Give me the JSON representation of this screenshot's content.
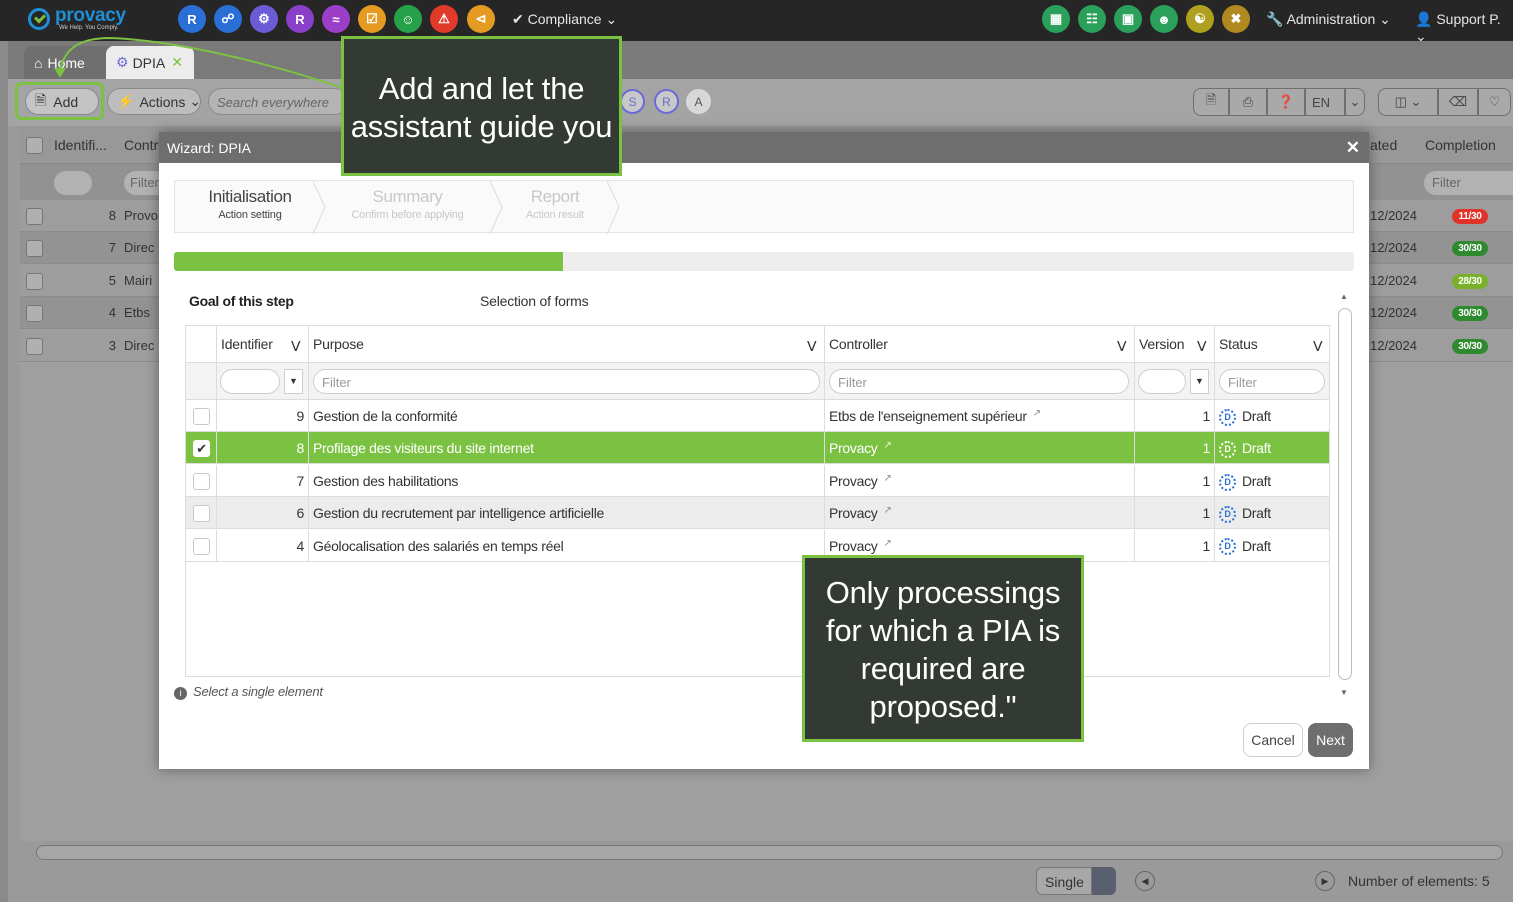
{
  "brand": {
    "name": "provacy",
    "tagline": "We Help. You Comply."
  },
  "topbar": {
    "app_icons": [
      {
        "label": "R",
        "color": "#2a6fd6",
        "icon": "letter-r"
      },
      {
        "label": "",
        "color": "#2a6fd6",
        "icon": "network-icon"
      },
      {
        "label": "",
        "color": "#6b5bd6",
        "icon": "gear-icon"
      },
      {
        "label": "R",
        "color": "#8a3fc8",
        "icon": "letter-r"
      },
      {
        "label": "",
        "color": "#9b3fc8",
        "icon": "handshake-icon"
      },
      {
        "label": "",
        "color": "#e59b22",
        "icon": "checklist-icon"
      },
      {
        "label": "",
        "color": "#27a04a",
        "icon": "user-icon"
      },
      {
        "label": "",
        "color": "#e23a2a",
        "icon": "shield-icon"
      },
      {
        "label": "",
        "color": "#e59b22",
        "icon": "share-icon"
      }
    ],
    "compliance": "Compliance",
    "right_icons": [
      {
        "color": "#2aa05a",
        "icon": "building-icon"
      },
      {
        "color": "#2aa05a",
        "icon": "org-chart-icon"
      },
      {
        "color": "#2aa05a",
        "icon": "office-icon"
      },
      {
        "color": "#2aa05a",
        "icon": "team-icon"
      },
      {
        "color": "#b0a020",
        "icon": "people-icon"
      },
      {
        "color": "#b08a20",
        "icon": "tools-icon"
      }
    ],
    "administration": "Administration",
    "support": "Support P."
  },
  "tabs": {
    "home": "Home",
    "dpia": "DPIA"
  },
  "toolbar": {
    "add": "Add",
    "actions": "Actions",
    "search_placeholder": "Search everywhere",
    "circles": [
      "S",
      "R",
      "A"
    ],
    "lang": "EN"
  },
  "bg_grid": {
    "headers": {
      "identifier": "Identifi...",
      "controller": "Contr",
      "updated": "ated",
      "completion": "Completion"
    },
    "filter": "Filter",
    "rows": [
      {
        "id": "8",
        "ctrl": "Provo",
        "date": "12/2024",
        "completion": "11/30",
        "color": "#e0342a"
      },
      {
        "id": "7",
        "ctrl": "Direc",
        "date": "12/2024",
        "completion": "30/30",
        "color": "#2f8a2f"
      },
      {
        "id": "5",
        "ctrl": "Mairi",
        "date": "12/2024",
        "completion": "28/30",
        "color": "#7ab02a"
      },
      {
        "id": "4",
        "ctrl": "Etbs",
        "date": "12/2024",
        "completion": "30/30",
        "color": "#2f8a2f"
      },
      {
        "id": "3",
        "ctrl": "Direc",
        "date": "12/2024",
        "completion": "30/30",
        "color": "#2f8a2f"
      }
    ]
  },
  "footer": {
    "single": "Single",
    "count": "Number of elements: 5"
  },
  "wizard": {
    "title": "Wizard: DPIA",
    "steps": [
      {
        "title": "Initialisation",
        "sub": "Action setting"
      },
      {
        "title": "Summary",
        "sub": "Confirm before applying"
      },
      {
        "title": "Report",
        "sub": "Action result"
      }
    ],
    "progress": 0.33,
    "goal": "Goal of this step",
    "selection": "Selection of forms",
    "columns": {
      "identifier": "Identifier",
      "purpose": "Purpose",
      "controller": "Controller",
      "version": "Version",
      "status": "Status"
    },
    "filter_placeholder": "Filter",
    "rows": [
      {
        "id": "9",
        "purpose": "Gestion de la conformité",
        "controller": "Etbs de l'enseignement supérieur",
        "version": "1",
        "status": "Draft"
      },
      {
        "id": "8",
        "purpose": "Profilage des visiteurs du site internet",
        "controller": "Provacy",
        "version": "1",
        "status": "Draft"
      },
      {
        "id": "7",
        "purpose": "Gestion des habilitations",
        "controller": "Provacy",
        "version": "1",
        "status": "Draft"
      },
      {
        "id": "6",
        "purpose": "Gestion du recrutement par intelligence artificielle",
        "controller": "Provacy",
        "version": "1",
        "status": "Draft"
      },
      {
        "id": "4",
        "purpose": "Géolocalisation des salariés en temps réel",
        "controller": "Provacy",
        "version": "1",
        "status": "Draft"
      }
    ],
    "hint": "Select a single element",
    "cancel": "Cancel",
    "next": "Next"
  },
  "callouts": {
    "top": "Add and let the assistant guide you",
    "bottom": "Only processings for which a PIA is required are proposed.\""
  }
}
